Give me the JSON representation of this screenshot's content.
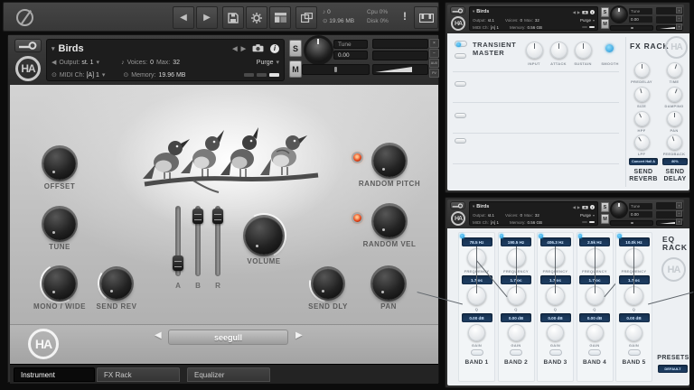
{
  "colors": {
    "accent_blue": "#2fb4ef",
    "navy": "#1d3c61",
    "led_orange": "#ff6a2a"
  },
  "icons": {
    "dropdown": "▾",
    "prev": "◀",
    "next": "▶",
    "note": "♪",
    "disc": "⊙",
    "info": "i",
    "warning": "!",
    "close": "×",
    "minus": "−",
    "plus": "+",
    "aux": "AUX",
    "pv": "PV",
    "logo_text": "HA"
  },
  "toolbar": {
    "voices_value": "0",
    "memory_value": "19.96 MB",
    "cpu": "Cpu 0%",
    "disk": "Disk 0%"
  },
  "main": {
    "header": {
      "title": "Birds",
      "output_label": "Output:",
      "output_value": "st. 1",
      "voices_label": "Voices:",
      "voices_value": "0",
      "max_label": "Max:",
      "max_value": "32",
      "purge": "Purge",
      "midi_label": "MIDI Ch:",
      "midi_value": "[A] 1",
      "memory_label": "Memory:",
      "memory_value": "19.96 MB",
      "solo": "S",
      "mute": "M",
      "tune_label": "Tune",
      "tune_value": "0.00"
    },
    "body": {
      "offset": "OFFSET",
      "tune": "TUNE",
      "mono_wide": "MONO / WIDE",
      "send_rev": "SEND REV",
      "volume": "VOLUME",
      "random_pitch": "RANDOM PITCH",
      "random_vel": "RANDOM VEL",
      "send_dly": "SEND DLY",
      "pan": "PAN",
      "slider_a": "A",
      "slider_b": "B",
      "slider_r": "R",
      "selector": "seegull"
    },
    "tabs": [
      {
        "label": "Instrument",
        "active": true
      },
      {
        "label": "FX Rack",
        "active": false
      },
      {
        "label": "Equalizer",
        "active": false
      }
    ]
  },
  "rack_header": {
    "title": "Birds",
    "output_label": "Output:",
    "output_value": "st.1",
    "voices_label": "Voices:",
    "voices_value": "0",
    "max_label": "Max:",
    "max_value": "32",
    "purge": "Purge",
    "midi_label": "MIDI Ch:",
    "midi_value": "[A] 1",
    "memory_label": "Memory:",
    "memory_value": "0.56 GB",
    "solo": "S",
    "mute": "M",
    "tune_label": "Tune",
    "tune_value": "0.00"
  },
  "fx_rack": {
    "title": "FX RACK",
    "transient": {
      "name": "TRANSIENT MASTER",
      "input": "INPUT",
      "attack": "ATTACK",
      "sustain": "SUSTAIN",
      "smooth": "SMOOTH"
    },
    "reverb": {
      "predelay": "PREDELAY",
      "size": "SIZE",
      "hpf": "HPF",
      "lpf": "LPF",
      "preset": "Concert Hall A",
      "send": "SEND REVERB"
    },
    "delay": {
      "time": "TIME",
      "damping": "DAMPING",
      "pan": "PAN",
      "feedback": "FEEDBACK",
      "preset": "80%",
      "send": "SEND DELAY"
    }
  },
  "eq_rack": {
    "title": "EQ RACK",
    "frequency_label": "FREQUENCY",
    "q_label": "Q",
    "gain_label": "GAIN",
    "presets_label": "PRESETS",
    "preset_value": "DEFAULT",
    "bands": [
      {
        "name": "BAND 1",
        "frequency": "78.5 Hz",
        "q": "1.7 oc",
        "gain": "0.00 dB"
      },
      {
        "name": "BAND 2",
        "frequency": "190.5 Hz",
        "q": "1.7 oc",
        "gain": "0.00 dB"
      },
      {
        "name": "BAND 3",
        "frequency": "406.3 Hz",
        "q": "1.7 oc",
        "gain": "0.00 dB"
      },
      {
        "name": "BAND 4",
        "frequency": "2.5k Hz",
        "q": "1.7 oc",
        "gain": "0.00 dB"
      },
      {
        "name": "BAND 5",
        "frequency": "10.0k Hz",
        "q": "1.7 oc",
        "gain": "0.00 dB"
      }
    ]
  }
}
